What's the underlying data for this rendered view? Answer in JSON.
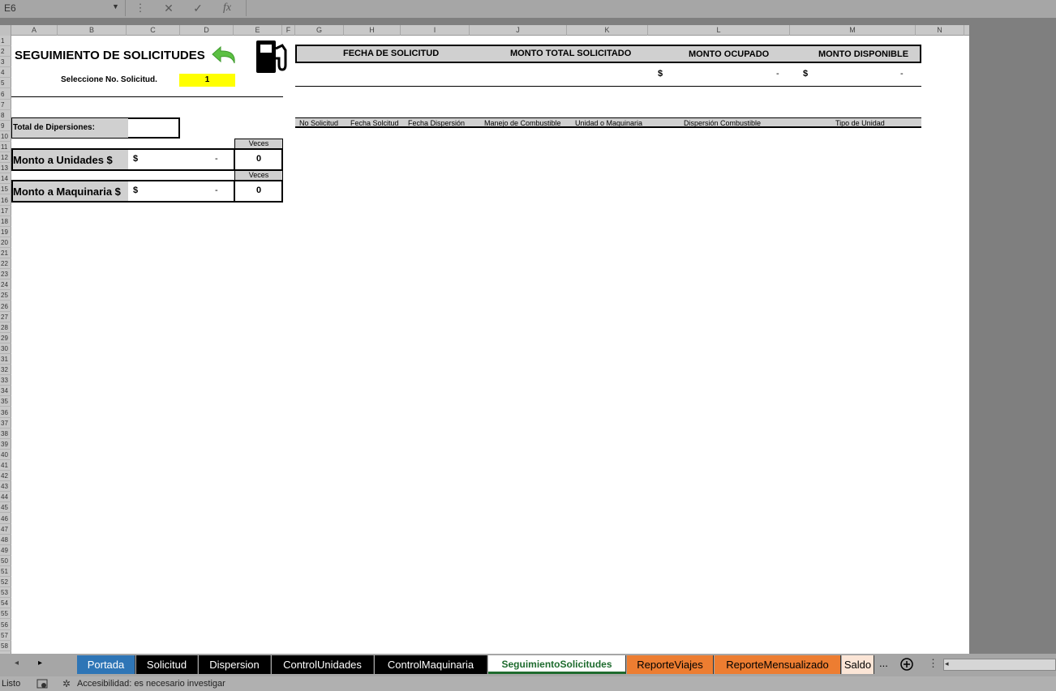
{
  "formula_bar": {
    "name_box": "E6",
    "cancel_glyph": "✕",
    "enter_glyph": "✓",
    "fx_glyph": "fx"
  },
  "columns": [
    "A",
    "B",
    "C",
    "D",
    "E",
    "F",
    "G",
    "H",
    "I",
    "J",
    "K",
    "L",
    "M",
    "N"
  ],
  "rows": [
    "1",
    "2",
    "3",
    "4",
    "5",
    "6",
    "7",
    "8",
    "9",
    "10",
    "11",
    "12",
    "13",
    "14",
    "15",
    "16",
    "17",
    "18",
    "19",
    "20",
    "21",
    "22",
    "23",
    "24",
    "25",
    "26",
    "27",
    "28",
    "29",
    "30",
    "31",
    "32",
    "33",
    "34",
    "35",
    "36",
    "37",
    "38",
    "39",
    "40",
    "41",
    "42",
    "43",
    "44",
    "45",
    "46",
    "47",
    "48",
    "49",
    "50",
    "51",
    "52",
    "53",
    "54",
    "55",
    "56",
    "57",
    "58"
  ],
  "sheet": {
    "title": "SEGUIMIENTO  DE SOLICITUDES",
    "select_label": "Seleccione No. Solicitud.",
    "select_value": "1",
    "summary_headers": [
      "FECHA DE SOLICITUD",
      "MONTO TOTAL SOLICITADO",
      "MONTO OCUPADO",
      "MONTO DISPONIBLE"
    ],
    "ocupado_currency": "$",
    "ocupado_value": "-",
    "disponible_currency": "$",
    "disponible_value": "-",
    "total_dispersiones_label": "Total de Dipersiones:",
    "veces_label": "Veces",
    "monto_unidades_label": "Monto a Unidades $",
    "monto_unidades_currency": "$",
    "monto_unidades_value": "-",
    "monto_unidades_veces": "0",
    "monto_maquinaria_label": "Monto a Maquinaria $",
    "monto_maquinaria_currency": "$",
    "monto_maquinaria_value": "-",
    "monto_maquinaria_veces": "0",
    "table_headers": [
      "No Solicitud",
      "Fecha Solcitud",
      "Fecha Dispersión",
      "Manejo de Combustible",
      "Unidad o Maquinaria",
      "Dispersión Combustible",
      "Tipo de Unidad"
    ]
  },
  "tabs": [
    {
      "label": "Portada",
      "bg": "#2e75b6",
      "fg": "#ffffff"
    },
    {
      "label": "Solicitud",
      "bg": "#000000",
      "fg": "#ffffff"
    },
    {
      "label": "Dispersion",
      "bg": "#000000",
      "fg": "#ffffff"
    },
    {
      "label": "ControlUnidades",
      "bg": "#000000",
      "fg": "#ffffff"
    },
    {
      "label": "ControlMaquinaria",
      "bg": "#000000",
      "fg": "#ffffff"
    },
    {
      "label": "SeguimientoSolicitudes",
      "bg": "#ffffff",
      "fg": "#1e6b2e"
    },
    {
      "label": "ReporteViajes",
      "bg": "#ed7d31",
      "fg": "#000000"
    },
    {
      "label": "ReporteMensualizado",
      "bg": "#ed7d31",
      "fg": "#000000"
    },
    {
      "label": "Saldo",
      "bg": "#fbe5d6",
      "fg": "#000000"
    }
  ],
  "tab_more": "...",
  "status": {
    "ready": "Listo",
    "accessibility": "Accesibilidad: es necesario investigar"
  },
  "icons": [
    "back-arrow-icon",
    "fuel-pump-icon",
    "add-sheet-icon"
  ],
  "colors": {
    "select_highlight": "#ffff00",
    "header_fill": "#d0d0d0",
    "back_arrow": "#5cc043"
  }
}
